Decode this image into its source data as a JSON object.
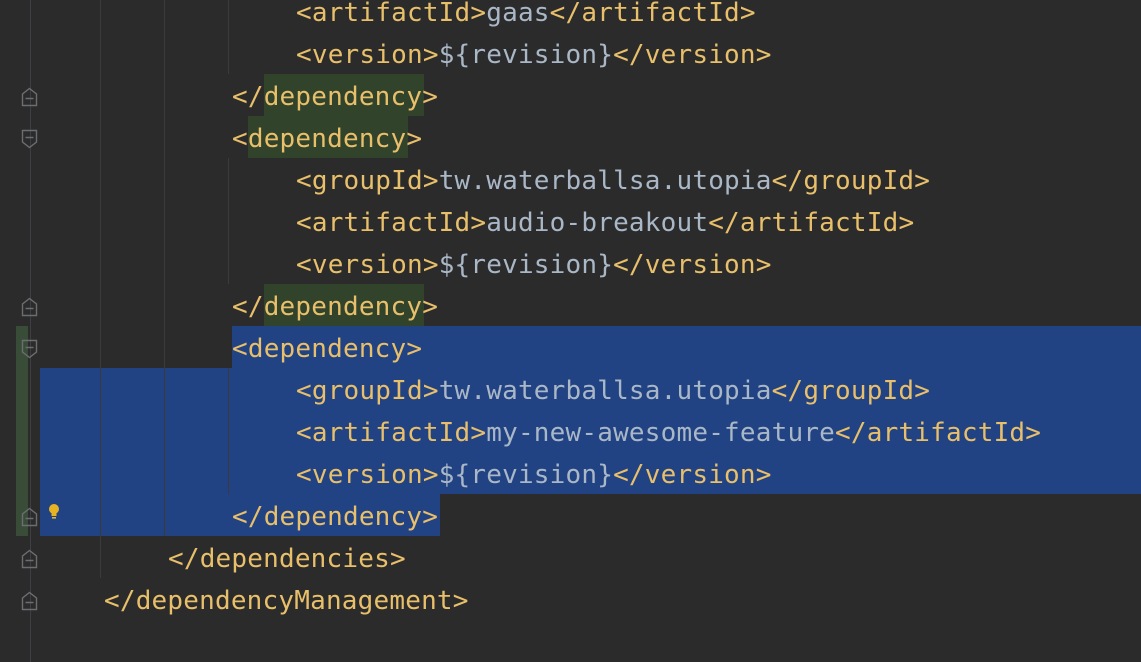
{
  "editor": {
    "language": "xml",
    "colors": {
      "background": "#2b2b2b",
      "tag": "#e8bf6a",
      "text": "#a9b7c6",
      "selection": "#214283",
      "tag_match_highlight": "#32432c",
      "changed_lines_marker": "#384c38",
      "bulb": "#e6b422"
    },
    "lines": [
      {
        "indent": 3,
        "open": "<artifactId>",
        "text": "gaas",
        "close": "</artifactId>"
      },
      {
        "indent": 3,
        "open": "<version>",
        "text": "${revision}",
        "close": "</version>"
      },
      {
        "indent": 2,
        "open": "</dependency>",
        "text": "",
        "close": ""
      },
      {
        "indent": 2,
        "open": "<dependency>",
        "text": "",
        "close": ""
      },
      {
        "indent": 3,
        "open": "<groupId>",
        "text": "tw.waterballsa.utopia",
        "close": "</groupId>"
      },
      {
        "indent": 3,
        "open": "<artifactId>",
        "text": "audio-breakout",
        "close": "</artifactId>"
      },
      {
        "indent": 3,
        "open": "<version>",
        "text": "${revision}",
        "close": "</version>"
      },
      {
        "indent": 2,
        "open": "</dependency>",
        "text": "",
        "close": ""
      },
      {
        "indent": 2,
        "open": "<dependency>",
        "text": "",
        "close": ""
      },
      {
        "indent": 3,
        "open": "<groupId>",
        "text": "tw.waterballsa.utopia",
        "close": "</groupId>"
      },
      {
        "indent": 3,
        "open": "<artifactId>",
        "text": "my-new-awesome-feature",
        "close": "</artifactId>"
      },
      {
        "indent": 3,
        "open": "<version>",
        "text": "${revision}",
        "close": "</version>"
      },
      {
        "indent": 2,
        "open": "</dependency>",
        "text": "",
        "close": ""
      },
      {
        "indent": 1,
        "open": "</dependencies>",
        "text": "",
        "close": ""
      },
      {
        "indent": 0,
        "open": "</dependencyManagement>",
        "text": "",
        "close": ""
      }
    ],
    "selected_lines": [
      8,
      9,
      10,
      11,
      12
    ],
    "fold_markers": [
      {
        "line": 2,
        "icon": "fold-end-icon"
      },
      {
        "line": 3,
        "icon": "fold-start-icon"
      },
      {
        "line": 7,
        "icon": "fold-end-icon"
      },
      {
        "line": 8,
        "icon": "fold-start-icon"
      },
      {
        "line": 12,
        "icon": "fold-end-icon"
      },
      {
        "line": 13,
        "icon": "fold-end-icon"
      },
      {
        "line": 14,
        "icon": "fold-end-icon"
      }
    ],
    "intention_bulb_line": 12
  }
}
